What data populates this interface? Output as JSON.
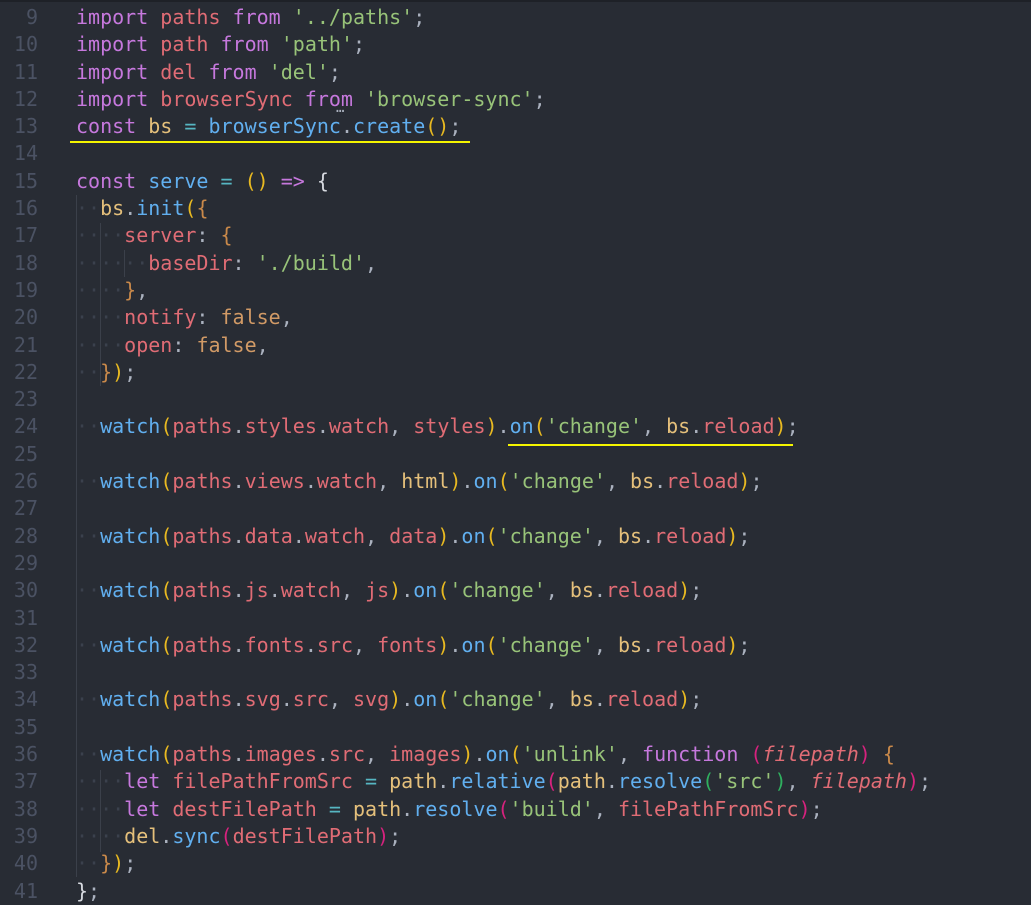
{
  "editor": {
    "colors": {
      "background": "#282c34",
      "underline": "#f5f500"
    },
    "lines": [
      {
        "n": "9",
        "t": [
          [
            "k",
            "import"
          ],
          [
            "p",
            " "
          ],
          [
            "v",
            "paths"
          ],
          [
            "p",
            " "
          ],
          [
            "k",
            "from"
          ],
          [
            "p",
            " "
          ],
          [
            "s",
            "'../paths'"
          ],
          [
            "p",
            ";"
          ]
        ]
      },
      {
        "n": "10",
        "t": [
          [
            "k",
            "import"
          ],
          [
            "p",
            " "
          ],
          [
            "v",
            "path"
          ],
          [
            "p",
            " "
          ],
          [
            "k",
            "from"
          ],
          [
            "p",
            " "
          ],
          [
            "s",
            "'path'"
          ],
          [
            "p",
            ";"
          ]
        ]
      },
      {
        "n": "11",
        "t": [
          [
            "k",
            "import"
          ],
          [
            "p",
            " "
          ],
          [
            "v",
            "del"
          ],
          [
            "p",
            " "
          ],
          [
            "k",
            "from"
          ],
          [
            "p",
            " "
          ],
          [
            "s",
            "'del'"
          ],
          [
            "p",
            ";"
          ]
        ]
      },
      {
        "n": "12",
        "t": [
          [
            "k",
            "import"
          ],
          [
            "p",
            " "
          ],
          [
            "v",
            "browserSync"
          ],
          [
            "p",
            " "
          ],
          [
            "k",
            "from"
          ],
          [
            "p",
            " "
          ],
          [
            "s",
            "'browser-sync'"
          ],
          [
            "p",
            ";"
          ]
        ]
      },
      {
        "n": "13",
        "t": [
          [
            "k",
            "const"
          ],
          [
            "p",
            " "
          ],
          [
            "o",
            "bs"
          ],
          [
            "p",
            " "
          ],
          [
            "op",
            "="
          ],
          [
            "p",
            " "
          ],
          [
            "f",
            "browserSync"
          ],
          [
            "p",
            "."
          ],
          [
            "f",
            "create"
          ],
          [
            "b1",
            "()"
          ],
          [
            "p",
            ";"
          ]
        ]
      },
      {
        "n": "14",
        "t": []
      },
      {
        "n": "15",
        "t": [
          [
            "k",
            "const"
          ],
          [
            "p",
            " "
          ],
          [
            "f",
            "serve"
          ],
          [
            "p",
            " "
          ],
          [
            "op",
            "="
          ],
          [
            "p",
            " "
          ],
          [
            "b1",
            "()"
          ],
          [
            "p",
            " "
          ],
          [
            "k",
            "=>"
          ],
          [
            "p",
            " "
          ],
          [
            "lb",
            "{"
          ]
        ]
      },
      {
        "n": "16",
        "t": [
          [
            "ind",
            "··"
          ],
          [
            "o",
            "bs"
          ],
          [
            "p",
            "."
          ],
          [
            "f",
            "init"
          ],
          [
            "b1",
            "("
          ],
          [
            "br",
            "{"
          ]
        ]
      },
      {
        "n": "17",
        "t": [
          [
            "ind",
            "····"
          ],
          [
            "v",
            "server"
          ],
          [
            "p",
            ":"
          ],
          [
            "p",
            " "
          ],
          [
            "br",
            "{"
          ]
        ]
      },
      {
        "n": "18",
        "t": [
          [
            "ind",
            "······"
          ],
          [
            "v",
            "baseDir"
          ],
          [
            "p",
            ":"
          ],
          [
            "p",
            " "
          ],
          [
            "s",
            "'./build'"
          ],
          [
            "p",
            ","
          ]
        ]
      },
      {
        "n": "19",
        "t": [
          [
            "ind",
            "····"
          ],
          [
            "br",
            "}"
          ],
          [
            "p",
            ","
          ]
        ]
      },
      {
        "n": "20",
        "t": [
          [
            "ind",
            "····"
          ],
          [
            "v",
            "notify"
          ],
          [
            "p",
            ":"
          ],
          [
            "p",
            " "
          ],
          [
            "bool",
            "false"
          ],
          [
            "p",
            ","
          ]
        ]
      },
      {
        "n": "21",
        "t": [
          [
            "ind",
            "····"
          ],
          [
            "v",
            "open"
          ],
          [
            "p",
            ":"
          ],
          [
            "p",
            " "
          ],
          [
            "bool",
            "false"
          ],
          [
            "p",
            ","
          ]
        ]
      },
      {
        "n": "22",
        "t": [
          [
            "ind",
            "··"
          ],
          [
            "br",
            "}"
          ],
          [
            "b1",
            ")"
          ],
          [
            "p",
            ";"
          ]
        ]
      },
      {
        "n": "23",
        "t": []
      },
      {
        "n": "24",
        "t": [
          [
            "ind",
            "··"
          ],
          [
            "f",
            "watch"
          ],
          [
            "b1",
            "("
          ],
          [
            "v",
            "paths"
          ],
          [
            "p",
            "."
          ],
          [
            "v",
            "styles"
          ],
          [
            "p",
            "."
          ],
          [
            "v",
            "watch"
          ],
          [
            "p",
            ", "
          ],
          [
            "v",
            "styles"
          ],
          [
            "b1",
            ")"
          ],
          [
            "p",
            "."
          ],
          [
            "f",
            "on"
          ],
          [
            "b1",
            "("
          ],
          [
            "s",
            "'change'"
          ],
          [
            "p",
            ", "
          ],
          [
            "o",
            "bs"
          ],
          [
            "p",
            "."
          ],
          [
            "v",
            "reload"
          ],
          [
            "b1",
            ")"
          ],
          [
            "p",
            ";"
          ]
        ]
      },
      {
        "n": "25",
        "t": []
      },
      {
        "n": "26",
        "t": [
          [
            "ind",
            "··"
          ],
          [
            "f",
            "watch"
          ],
          [
            "b1",
            "("
          ],
          [
            "v",
            "paths"
          ],
          [
            "p",
            "."
          ],
          [
            "v",
            "views"
          ],
          [
            "p",
            "."
          ],
          [
            "v",
            "watch"
          ],
          [
            "p",
            ", "
          ],
          [
            "o",
            "html"
          ],
          [
            "b1",
            ")"
          ],
          [
            "p",
            "."
          ],
          [
            "f",
            "on"
          ],
          [
            "b1",
            "("
          ],
          [
            "s",
            "'change'"
          ],
          [
            "p",
            ", "
          ],
          [
            "o",
            "bs"
          ],
          [
            "p",
            "."
          ],
          [
            "v",
            "reload"
          ],
          [
            "b1",
            ")"
          ],
          [
            "p",
            ";"
          ]
        ]
      },
      {
        "n": "27",
        "t": []
      },
      {
        "n": "28",
        "t": [
          [
            "ind",
            "··"
          ],
          [
            "f",
            "watch"
          ],
          [
            "b1",
            "("
          ],
          [
            "v",
            "paths"
          ],
          [
            "p",
            "."
          ],
          [
            "v",
            "data"
          ],
          [
            "p",
            "."
          ],
          [
            "v",
            "watch"
          ],
          [
            "p",
            ", "
          ],
          [
            "v",
            "data"
          ],
          [
            "b1",
            ")"
          ],
          [
            "p",
            "."
          ],
          [
            "f",
            "on"
          ],
          [
            "b1",
            "("
          ],
          [
            "s",
            "'change'"
          ],
          [
            "p",
            ", "
          ],
          [
            "o",
            "bs"
          ],
          [
            "p",
            "."
          ],
          [
            "v",
            "reload"
          ],
          [
            "b1",
            ")"
          ],
          [
            "p",
            ";"
          ]
        ]
      },
      {
        "n": "29",
        "t": []
      },
      {
        "n": "30",
        "t": [
          [
            "ind",
            "··"
          ],
          [
            "f",
            "watch"
          ],
          [
            "b1",
            "("
          ],
          [
            "v",
            "paths"
          ],
          [
            "p",
            "."
          ],
          [
            "v",
            "js"
          ],
          [
            "p",
            "."
          ],
          [
            "v",
            "watch"
          ],
          [
            "p",
            ", "
          ],
          [
            "v",
            "js"
          ],
          [
            "b1",
            ")"
          ],
          [
            "p",
            "."
          ],
          [
            "f",
            "on"
          ],
          [
            "b1",
            "("
          ],
          [
            "s",
            "'change'"
          ],
          [
            "p",
            ", "
          ],
          [
            "o",
            "bs"
          ],
          [
            "p",
            "."
          ],
          [
            "v",
            "reload"
          ],
          [
            "b1",
            ")"
          ],
          [
            "p",
            ";"
          ]
        ]
      },
      {
        "n": "31",
        "t": []
      },
      {
        "n": "32",
        "t": [
          [
            "ind",
            "··"
          ],
          [
            "f",
            "watch"
          ],
          [
            "b1",
            "("
          ],
          [
            "v",
            "paths"
          ],
          [
            "p",
            "."
          ],
          [
            "v",
            "fonts"
          ],
          [
            "p",
            "."
          ],
          [
            "v",
            "src"
          ],
          [
            "p",
            ", "
          ],
          [
            "v",
            "fonts"
          ],
          [
            "b1",
            ")"
          ],
          [
            "p",
            "."
          ],
          [
            "f",
            "on"
          ],
          [
            "b1",
            "("
          ],
          [
            "s",
            "'change'"
          ],
          [
            "p",
            ", "
          ],
          [
            "o",
            "bs"
          ],
          [
            "p",
            "."
          ],
          [
            "v",
            "reload"
          ],
          [
            "b1",
            ")"
          ],
          [
            "p",
            ";"
          ]
        ]
      },
      {
        "n": "33",
        "t": []
      },
      {
        "n": "34",
        "t": [
          [
            "ind",
            "··"
          ],
          [
            "f",
            "watch"
          ],
          [
            "b1",
            "("
          ],
          [
            "v",
            "paths"
          ],
          [
            "p",
            "."
          ],
          [
            "v",
            "svg"
          ],
          [
            "p",
            "."
          ],
          [
            "v",
            "src"
          ],
          [
            "p",
            ", "
          ],
          [
            "v",
            "svg"
          ],
          [
            "b1",
            ")"
          ],
          [
            "p",
            "."
          ],
          [
            "f",
            "on"
          ],
          [
            "b1",
            "("
          ],
          [
            "s",
            "'change'"
          ],
          [
            "p",
            ", "
          ],
          [
            "o",
            "bs"
          ],
          [
            "p",
            "."
          ],
          [
            "v",
            "reload"
          ],
          [
            "b1",
            ")"
          ],
          [
            "p",
            ";"
          ]
        ]
      },
      {
        "n": "35",
        "t": []
      },
      {
        "n": "36",
        "t": [
          [
            "ind",
            "··"
          ],
          [
            "f",
            "watch"
          ],
          [
            "b1",
            "("
          ],
          [
            "v",
            "paths"
          ],
          [
            "p",
            "."
          ],
          [
            "v",
            "images"
          ],
          [
            "p",
            "."
          ],
          [
            "v",
            "src"
          ],
          [
            "p",
            ", "
          ],
          [
            "v",
            "images"
          ],
          [
            "b1",
            ")"
          ],
          [
            "p",
            "."
          ],
          [
            "f",
            "on"
          ],
          [
            "b1",
            "("
          ],
          [
            "s",
            "'unlink'"
          ],
          [
            "p",
            ", "
          ],
          [
            "k",
            "function"
          ],
          [
            "p",
            " "
          ],
          [
            "b2",
            "("
          ],
          [
            "param",
            "filepath"
          ],
          [
            "b2",
            ")"
          ],
          [
            "p",
            " "
          ],
          [
            "br",
            "{"
          ]
        ]
      },
      {
        "n": "37",
        "t": [
          [
            "ind",
            "····"
          ],
          [
            "k",
            "let"
          ],
          [
            "p",
            " "
          ],
          [
            "v",
            "filePathFromSrc"
          ],
          [
            "p",
            " "
          ],
          [
            "op",
            "="
          ],
          [
            "p",
            " "
          ],
          [
            "o",
            "path"
          ],
          [
            "p",
            "."
          ],
          [
            "f",
            "relative"
          ],
          [
            "b2",
            "("
          ],
          [
            "o",
            "path"
          ],
          [
            "p",
            "."
          ],
          [
            "f",
            "resolve"
          ],
          [
            "b3",
            "("
          ],
          [
            "s",
            "'src'"
          ],
          [
            "b3",
            ")"
          ],
          [
            "p",
            ", "
          ],
          [
            "param",
            "filepath"
          ],
          [
            "b2",
            ")"
          ],
          [
            "p",
            ";"
          ]
        ]
      },
      {
        "n": "38",
        "t": [
          [
            "ind",
            "····"
          ],
          [
            "k",
            "let"
          ],
          [
            "p",
            " "
          ],
          [
            "v",
            "destFilePath"
          ],
          [
            "p",
            " "
          ],
          [
            "op",
            "="
          ],
          [
            "p",
            " "
          ],
          [
            "o",
            "path"
          ],
          [
            "p",
            "."
          ],
          [
            "f",
            "resolve"
          ],
          [
            "b2",
            "("
          ],
          [
            "s",
            "'build'"
          ],
          [
            "p",
            ", "
          ],
          [
            "v",
            "filePathFromSrc"
          ],
          [
            "b2",
            ")"
          ],
          [
            "p",
            ";"
          ]
        ]
      },
      {
        "n": "39",
        "t": [
          [
            "ind",
            "····"
          ],
          [
            "o",
            "del"
          ],
          [
            "p",
            "."
          ],
          [
            "f",
            "sync"
          ],
          [
            "b2",
            "("
          ],
          [
            "v",
            "destFilePath"
          ],
          [
            "b2",
            ")"
          ],
          [
            "p",
            ";"
          ]
        ]
      },
      {
        "n": "40",
        "t": [
          [
            "ind",
            "··"
          ],
          [
            "br",
            "}"
          ],
          [
            "b1",
            ")"
          ],
          [
            "p",
            ";"
          ]
        ]
      },
      {
        "n": "41",
        "t": [
          [
            "lb",
            "}"
          ],
          [
            "p",
            ";"
          ]
        ]
      }
    ]
  }
}
